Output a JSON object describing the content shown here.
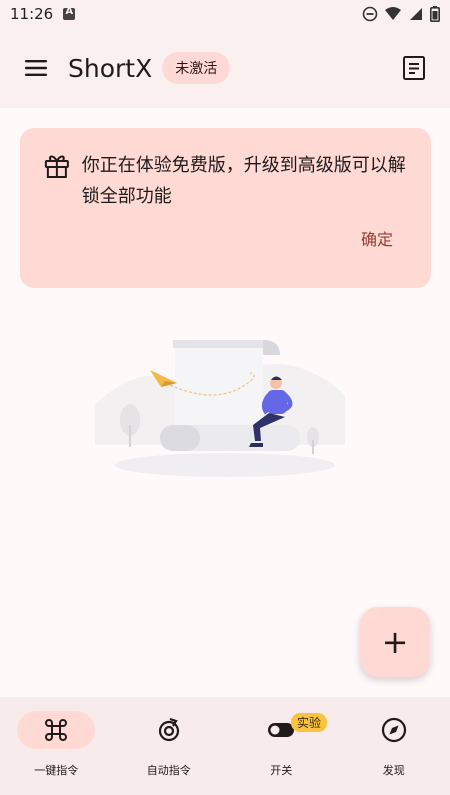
{
  "status_bar": {
    "time": "11:26"
  },
  "app_bar": {
    "title": "ShortX",
    "badge": "未激活"
  },
  "banner": {
    "message": "你正在体验免费版，升级到高级版可以解锁全部功能",
    "confirm": "确定"
  },
  "fab": {
    "label": "+"
  },
  "bottom_nav": {
    "items": [
      {
        "label": "一键指令",
        "icon": "command-icon",
        "active": true
      },
      {
        "label": "自动指令",
        "icon": "auto-icon",
        "active": false
      },
      {
        "label": "开关",
        "icon": "toggle-icon",
        "active": false,
        "badge": "实验"
      },
      {
        "label": "发现",
        "icon": "compass-icon",
        "active": false
      }
    ]
  },
  "colors": {
    "app_bar_bg": "#fbf0f0",
    "banner_bg": "#ffdad5",
    "accent_text": "#9a3b32",
    "experiment_badge": "#f9c341"
  }
}
